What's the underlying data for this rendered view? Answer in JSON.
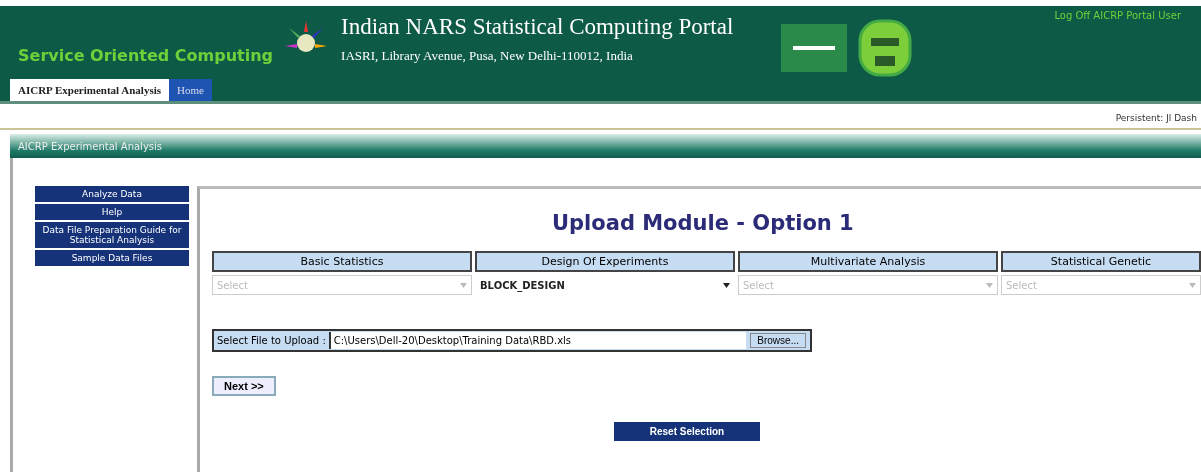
{
  "header": {
    "brand": "Service Oriented Computing",
    "title": "Indian NARS Statistical Computing Portal",
    "address": "IASRI, Library Avenue, Pusa, New Delhi-110012, India",
    "logout": "Log Off AICRP Portal User"
  },
  "tabs": [
    {
      "label": "AICRP Experimental Analysis",
      "selected": true
    },
    {
      "label": "Home",
      "selected": false
    }
  ],
  "user_strip": "Persistent: Jl Dash",
  "section_title": "AICRP Experimental Analysis",
  "sidebar": {
    "items": [
      {
        "label": "Analyze Data"
      },
      {
        "label": "Help"
      },
      {
        "label": "Data File Preparation Guide for Statistical Analysis"
      },
      {
        "label": "Sample Data Files"
      }
    ]
  },
  "main": {
    "title": "Upload Module - Option 1",
    "categories": [
      {
        "label": "Basic Statistics",
        "placeholder": "Select",
        "disabled": true
      },
      {
        "label": "Design Of Experiments",
        "value": "BLOCK_DESIGN",
        "disabled": false
      },
      {
        "label": "Multivariate Analysis",
        "placeholder": "Select",
        "disabled": true
      },
      {
        "label": "Statistical Genetic",
        "placeholder": "Select",
        "disabled": true
      }
    ],
    "file_label": "Select File to Upload :",
    "file_value": "C:\\Users\\Dell-20\\Desktop\\Training Data\\RBD.xls",
    "browse": "Browse...",
    "next": "Next >>",
    "reset": "Reset Selection"
  }
}
